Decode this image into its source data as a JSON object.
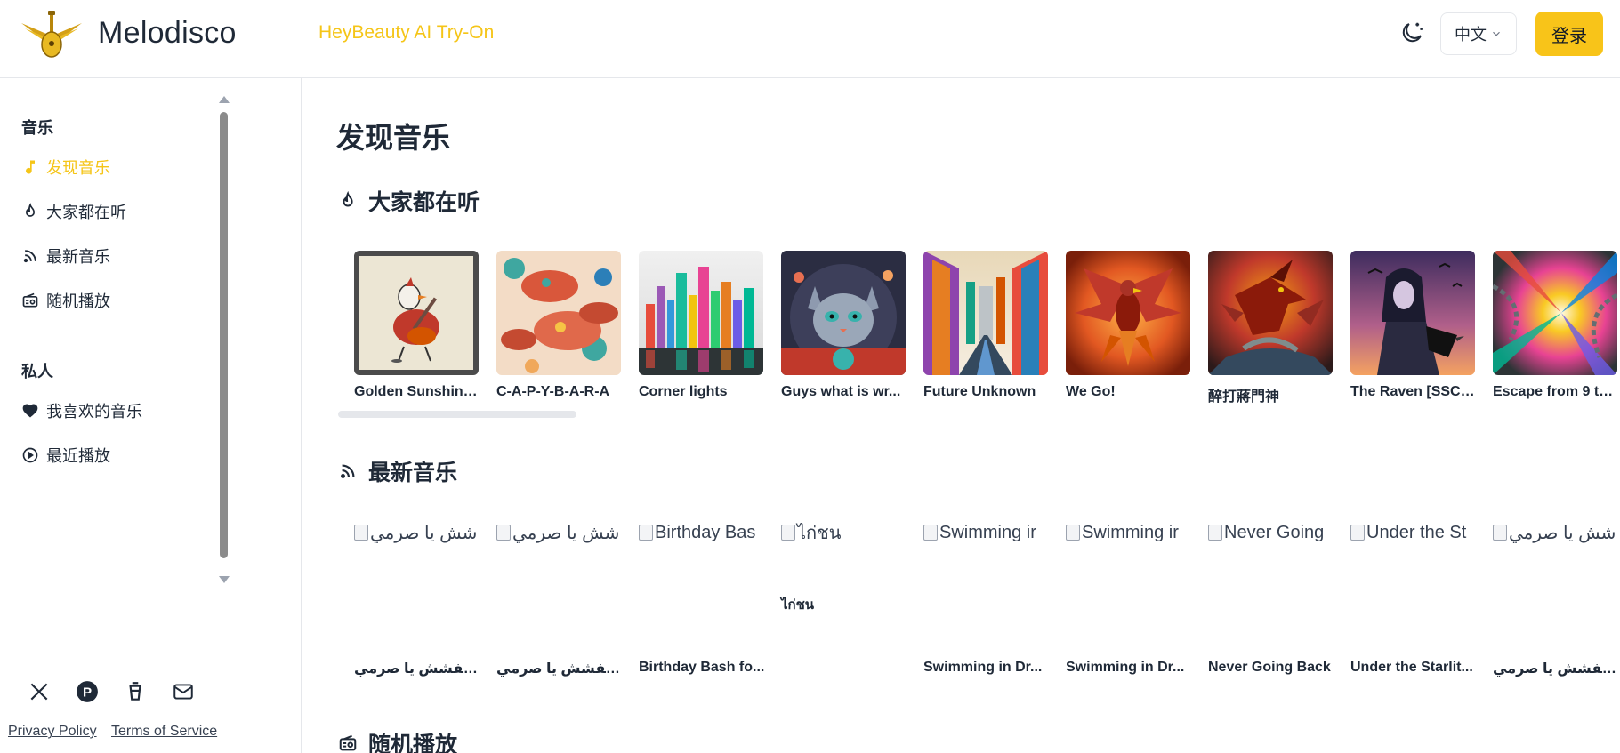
{
  "header": {
    "brand": "Melodisco",
    "promo_link": "HeyBeauty AI Try-On",
    "language": "中文",
    "login_label": "登录"
  },
  "sidebar": {
    "section_music": "音乐",
    "items_music": [
      {
        "label": "发现音乐",
        "icon": "music-note-icon",
        "active": true
      },
      {
        "label": "大家都在听",
        "icon": "fire-icon"
      },
      {
        "label": "最新音乐",
        "icon": "rss-icon"
      },
      {
        "label": "随机播放",
        "icon": "radio-icon"
      }
    ],
    "section_private": "私人",
    "items_private": [
      {
        "label": "我喜欢的音乐",
        "icon": "heart-icon"
      },
      {
        "label": "最近播放",
        "icon": "play-circle-icon"
      }
    ],
    "social": [
      "x-icon",
      "product-hunt-icon",
      "coffee-cup-icon",
      "mail-icon"
    ],
    "privacy": "Privacy Policy",
    "terms": "Terms of Service"
  },
  "main": {
    "title": "发现音乐",
    "trending_title": "大家都在听",
    "trending": [
      {
        "title": "Golden Sunshine..."
      },
      {
        "title": "C-A-P-Y-B-A-R-A"
      },
      {
        "title": "Corner lights"
      },
      {
        "title": "Guys what is wr..."
      },
      {
        "title": "Future Unknown"
      },
      {
        "title": "We Go!"
      },
      {
        "title": "醉打蔣門神"
      },
      {
        "title": "The Raven [SSC3..."
      },
      {
        "title": "Escape from 9 to..."
      }
    ],
    "latest_title": "最新音乐",
    "latest": [
      {
        "alt": "شش يا صرمي",
        "title": "تفشش يا صرمي..."
      },
      {
        "alt": "شش يا صرمي",
        "title": "تفشش يا صرمي..."
      },
      {
        "alt": "Birthday Bas",
        "title": "Birthday Bash fo..."
      },
      {
        "alt": "ไก่ชน",
        "title": "ไก่ชน"
      },
      {
        "alt": "Swimming ir",
        "title": "Swimming in Dr..."
      },
      {
        "alt": "Swimming ir",
        "title": "Swimming in Dr..."
      },
      {
        "alt": "Never Going",
        "title": "Never Going Back"
      },
      {
        "alt": "Under the St",
        "title": "Under the Starlit..."
      },
      {
        "alt": "شش يا صرمي",
        "title": "تفشش يا صرمي..."
      }
    ],
    "random_title": "随机播放"
  }
}
